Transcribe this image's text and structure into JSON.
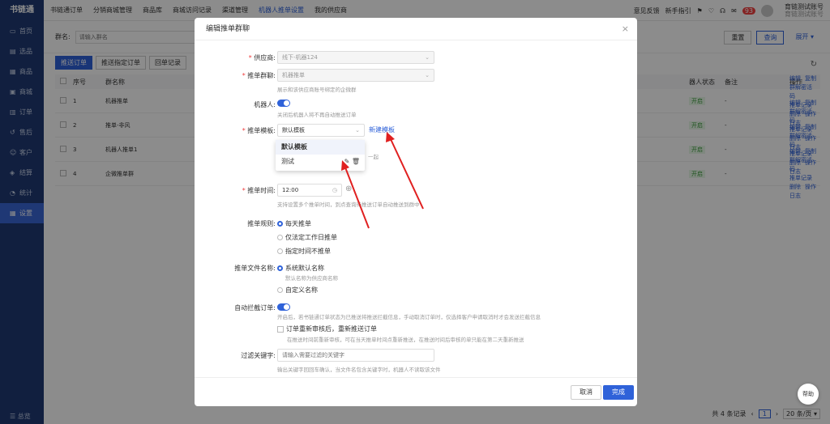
{
  "app": {
    "logo": "书链通"
  },
  "sidebar": {
    "items": [
      {
        "icon": "▭",
        "label": "首页"
      },
      {
        "icon": "▤",
        "label": "选品"
      },
      {
        "icon": "▦",
        "label": "商品"
      },
      {
        "icon": "▣",
        "label": "商城"
      },
      {
        "icon": "▥",
        "label": "订单"
      },
      {
        "icon": "↺",
        "label": "售后"
      },
      {
        "icon": "☺",
        "label": "客户"
      },
      {
        "icon": "◈",
        "label": "结算"
      },
      {
        "icon": "◔",
        "label": "统计"
      },
      {
        "icon": "▦",
        "label": "设置"
      }
    ],
    "bottom": "☰ 总览"
  },
  "topnav": [
    "书链通订单",
    "分销商城管理",
    "商品库",
    "商城访问记录",
    "渠道管理",
    "机器人推单设置",
    "我的供应商"
  ],
  "topright": {
    "feedback": "意见反馈",
    "guide": "新手指引",
    "badge": "93",
    "user_name": "育链测试账号",
    "user_sub": "育链测试账号"
  },
  "filter": {
    "label": "群名:",
    "placeholder": "请输入群名",
    "reset": "重置",
    "search": "查询",
    "expand": "展开 ▾"
  },
  "tabs": [
    "推送订单",
    "推送指定订单",
    "回单记录"
  ],
  "table": {
    "headers": {
      "no": "序号",
      "name": "群名称",
      "status": "器人状态",
      "note": "备注",
      "op": "操作"
    },
    "rows": [
      {
        "no": "1",
        "name": "机器推单",
        "status": "开启",
        "note": "-"
      },
      {
        "no": "2",
        "name": "推单-非风",
        "status": "开启",
        "note": "-"
      },
      {
        "no": "3",
        "name": "机器人推单1",
        "status": "开启",
        "note": "-"
      },
      {
        "no": "4",
        "name": "企微推单群",
        "status": "开启",
        "note": "-"
      }
    ],
    "ops": [
      "编辑",
      "复制群解密活码",
      "推单记录",
      "删除",
      "操作日志"
    ]
  },
  "pager": {
    "total": "共 4 条记录",
    "page": "1",
    "size": "20 条/页 ▾"
  },
  "modal": {
    "title": "编辑推单群聊",
    "close": "×",
    "supplier": {
      "label": "供应商:",
      "value": "线下-机器124"
    },
    "group": {
      "label": "推单群聊:",
      "value": "机器推单",
      "hint": "展示和该供应商账号绑定的企微群"
    },
    "robot": {
      "label": "机器人:",
      "hint": "关闭后机器人将不再自动推送订单"
    },
    "template": {
      "label": "推单模板:",
      "value": "默认模板",
      "new": "新建模板",
      "hint_tail": "一起",
      "options": [
        "默认模板",
        "测试"
      ]
    },
    "time": {
      "label": "推单时间:",
      "value": "12:00",
      "hint": "支持设置多个推单时间，到点查询待推送订单自动推送到群中"
    },
    "rule": {
      "label": "推单规则:",
      "options": [
        "每天推单",
        "仅法定工作日推单",
        "指定时间不推单"
      ]
    },
    "filename": {
      "label": "推单文件名称:",
      "options": [
        "系统默认名称",
        "自定义名称"
      ],
      "hint": "默认名称为供应商名称"
    },
    "intercept": {
      "label": "自动拦截订单:",
      "hint": "开启后，若书链通订单状态为已推送将推送拦截信息，手动取消订单时，仅选择客户申请取消时才会发送拦截信息",
      "check": "订单重新审核后，重新推送订单",
      "check_hint": "在推送时间前重新审核，可在当天推单时间点重新推送，在推送时间后审核的单只能在第二天重新推送"
    },
    "keyword": {
      "label": "过滤关键字:",
      "placeholder": "请输入需要过滤的关键字",
      "hint": "输出关键字回回车确认，当文件名包含关键字时，机器人不读取该文件"
    },
    "cancel": "取消",
    "confirm": "完成"
  },
  "help": "帮助"
}
